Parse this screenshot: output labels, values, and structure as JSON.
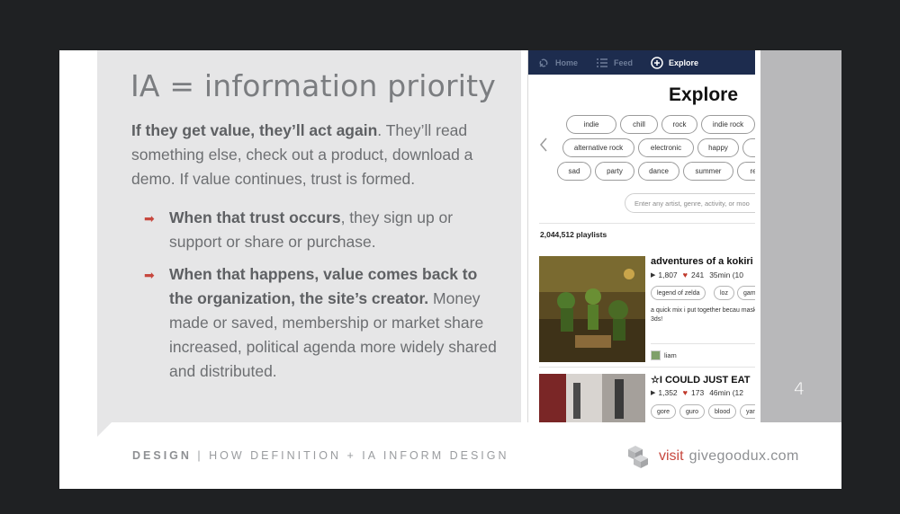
{
  "slide": {
    "title": "IA = information priority",
    "intro_bold": "If they get value, they’ll act again",
    "intro_rest": ". They’ll read something else, check out a product, download a demo. If value continues, trust is formed.",
    "bullets": [
      {
        "bold": "When that trust occurs",
        "rest": ", they sign up or support or share or purchase."
      },
      {
        "bold": "When that happens, value comes back to the organization, the site’s creator.",
        "rest": " Money made or saved, membership or market share increased, political agenda more widely shared and distributed."
      }
    ],
    "slide_number": "4",
    "footer_bold": "DESIGN",
    "footer_rest": " | HOW DEFINITION + IA INFORM DESIGN",
    "footer_visit": "visit",
    "footer_site": "givegoodux.com",
    "colors": {
      "accent": "#c7483f",
      "panel": "#e6e6e7",
      "nav": "#1d2c4e"
    }
  },
  "app": {
    "nav": [
      {
        "label": "Home",
        "icon": "link-icon"
      },
      {
        "label": "Feed",
        "icon": "list-icon"
      },
      {
        "label": "Explore",
        "icon": "compass-icon"
      }
    ],
    "explore_title": "Explore",
    "tags_row1": [
      "indie",
      "chill",
      "rock",
      "indie rock"
    ],
    "tags_row2": [
      "alternative rock",
      "electronic",
      "happy",
      ""
    ],
    "tags_row3": [
      "sad",
      "party",
      "dance",
      "summer",
      "re"
    ],
    "search_placeholder": "Enter any artist, genre, activity, or moo",
    "playlist_count": "2,044,512 playlists",
    "playlists": [
      {
        "title": "adventures of a kokiri",
        "plays": "1,807",
        "likes": "241",
        "duration": "35min (10",
        "tags": [
          "legend of zelda",
          "loz",
          "gam"
        ],
        "description": "a quick mix i put together becau mask 3ds!",
        "user": "liam"
      },
      {
        "title": "☆I COULD JUST EAT",
        "plays": "1,352",
        "likes": "173",
        "duration": "46min (12",
        "tags": [
          "gore",
          "guro",
          "blood",
          "yan"
        ]
      }
    ]
  }
}
